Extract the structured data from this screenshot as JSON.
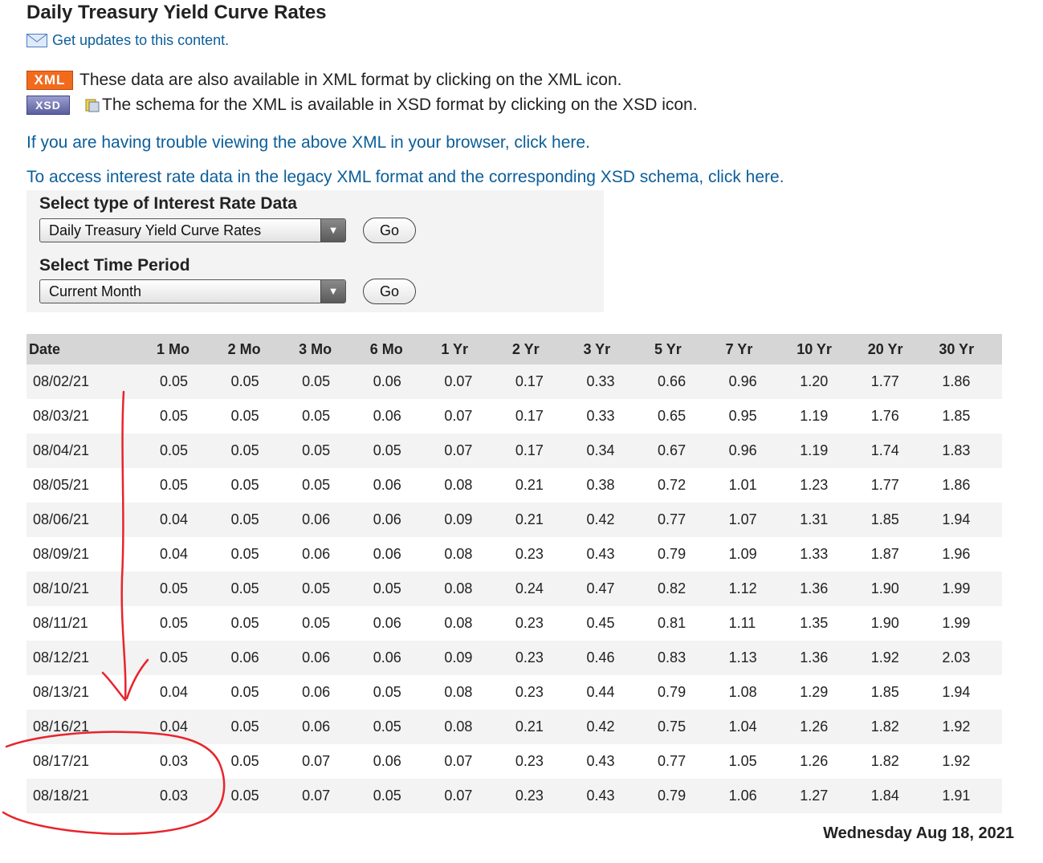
{
  "title": "Daily Treasury Yield Curve Rates",
  "updates_link": "Get updates to this content.",
  "xml_badge": "XML",
  "xml_text": "These data are also available in XML format by clicking on the XML icon.",
  "xsd_badge": "XSD",
  "xsd_text": "The schema for the XML is available in XSD format by clicking on the XSD icon.",
  "trouble_link": "If you are having trouble viewing the above XML in your browser, click here.",
  "legacy_link": "To access interest rate data in the legacy XML format and the corresponding XSD schema, click here.",
  "selector": {
    "type_label": "Select type of Interest Rate Data",
    "type_value": "Daily Treasury Yield Curve Rates",
    "period_label": "Select Time Period",
    "period_value": "Current Month",
    "go_label": "Go"
  },
  "table": {
    "headers": [
      "Date",
      "1 Mo",
      "2 Mo",
      "3 Mo",
      "6 Mo",
      "1 Yr",
      "2 Yr",
      "3 Yr",
      "5 Yr",
      "7 Yr",
      "10 Yr",
      "20 Yr",
      "30 Yr"
    ],
    "rows": [
      [
        "08/02/21",
        "0.05",
        "0.05",
        "0.05",
        "0.06",
        "0.07",
        "0.17",
        "0.33",
        "0.66",
        "0.96",
        "1.20",
        "1.77",
        "1.86"
      ],
      [
        "08/03/21",
        "0.05",
        "0.05",
        "0.05",
        "0.06",
        "0.07",
        "0.17",
        "0.33",
        "0.65",
        "0.95",
        "1.19",
        "1.76",
        "1.85"
      ],
      [
        "08/04/21",
        "0.05",
        "0.05",
        "0.05",
        "0.05",
        "0.07",
        "0.17",
        "0.34",
        "0.67",
        "0.96",
        "1.19",
        "1.74",
        "1.83"
      ],
      [
        "08/05/21",
        "0.05",
        "0.05",
        "0.05",
        "0.06",
        "0.08",
        "0.21",
        "0.38",
        "0.72",
        "1.01",
        "1.23",
        "1.77",
        "1.86"
      ],
      [
        "08/06/21",
        "0.04",
        "0.05",
        "0.06",
        "0.06",
        "0.09",
        "0.21",
        "0.42",
        "0.77",
        "1.07",
        "1.31",
        "1.85",
        "1.94"
      ],
      [
        "08/09/21",
        "0.04",
        "0.05",
        "0.06",
        "0.06",
        "0.08",
        "0.23",
        "0.43",
        "0.79",
        "1.09",
        "1.33",
        "1.87",
        "1.96"
      ],
      [
        "08/10/21",
        "0.05",
        "0.05",
        "0.05",
        "0.05",
        "0.08",
        "0.24",
        "0.47",
        "0.82",
        "1.12",
        "1.36",
        "1.90",
        "1.99"
      ],
      [
        "08/11/21",
        "0.05",
        "0.05",
        "0.05",
        "0.06",
        "0.08",
        "0.23",
        "0.45",
        "0.81",
        "1.11",
        "1.35",
        "1.90",
        "1.99"
      ],
      [
        "08/12/21",
        "0.05",
        "0.06",
        "0.06",
        "0.06",
        "0.09",
        "0.23",
        "0.46",
        "0.83",
        "1.13",
        "1.36",
        "1.92",
        "2.03"
      ],
      [
        "08/13/21",
        "0.04",
        "0.05",
        "0.06",
        "0.05",
        "0.08",
        "0.23",
        "0.44",
        "0.79",
        "1.08",
        "1.29",
        "1.85",
        "1.94"
      ],
      [
        "08/16/21",
        "0.04",
        "0.05",
        "0.06",
        "0.05",
        "0.08",
        "0.21",
        "0.42",
        "0.75",
        "1.04",
        "1.26",
        "1.82",
        "1.92"
      ],
      [
        "08/17/21",
        "0.03",
        "0.05",
        "0.07",
        "0.06",
        "0.07",
        "0.23",
        "0.43",
        "0.77",
        "1.05",
        "1.26",
        "1.82",
        "1.92"
      ],
      [
        "08/18/21",
        "0.03",
        "0.05",
        "0.07",
        "0.05",
        "0.07",
        "0.23",
        "0.43",
        "0.79",
        "1.06",
        "1.27",
        "1.84",
        "1.91"
      ]
    ]
  },
  "date_stamp": "Wednesday Aug 18, 2021",
  "colors": {
    "link": "#0b5e9a",
    "xml_badge": "#f26b1d",
    "xsd_badge": "#5a5f9e",
    "header_bg": "#d6d6d6",
    "row_alt_bg": "#f3f3f3",
    "annotation": "#e8242c"
  },
  "icons": {
    "mail": "mail-icon",
    "schema": "schema-icon",
    "dropdown": "chevron-down-icon"
  }
}
